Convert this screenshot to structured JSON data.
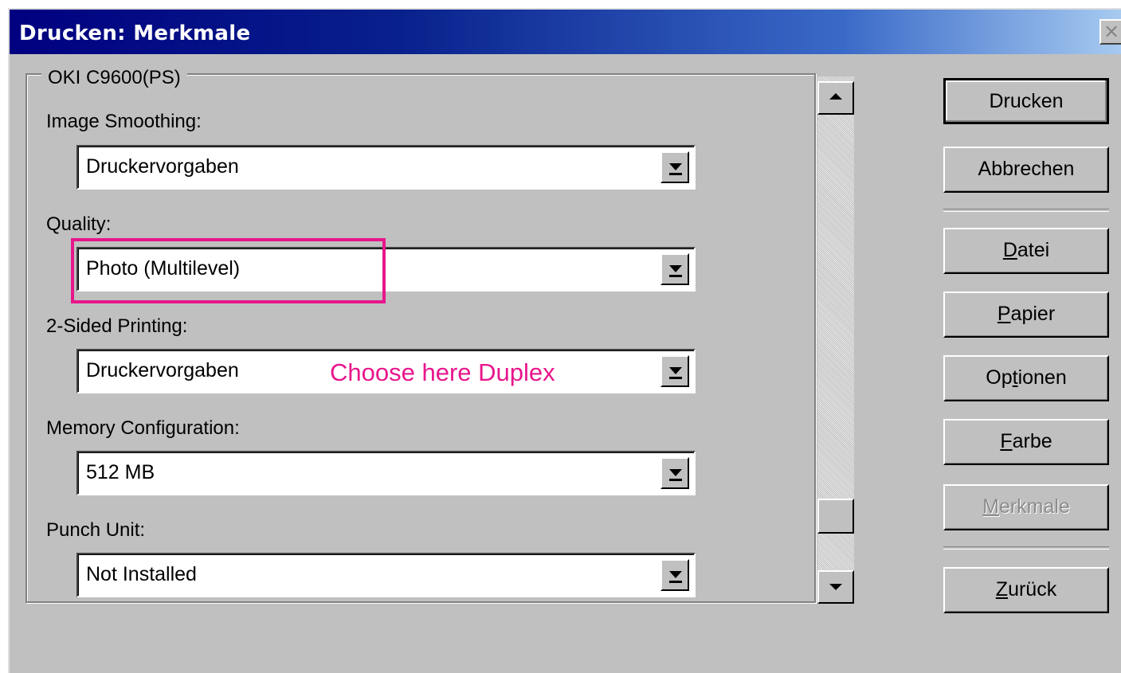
{
  "window": {
    "title": "Drucken: Merkmale",
    "close_label": "×"
  },
  "group": {
    "legend": "OKI C9600(PS)",
    "fields": [
      {
        "label": "Image Smoothing:",
        "value": "Druckervorgaben"
      },
      {
        "label": "Quality:",
        "value": "Photo (Multilevel)"
      },
      {
        "label": "2-Sided Printing:",
        "value": "Druckervorgaben"
      },
      {
        "label": "Memory Configuration:",
        "value": "512 MB"
      },
      {
        "label": "Punch Unit:",
        "value": "Not Installed"
      }
    ]
  },
  "buttons": {
    "print": "Drucken",
    "cancel": "Abbrechen",
    "file_mnemonic": "D",
    "file_rest": "atei",
    "paper_mnemonic": "P",
    "paper_rest": "apier",
    "options_pre": "Op",
    "options_mnemonic": "t",
    "options_rest": "ionen",
    "color_mnemonic": "F",
    "color_rest": "arbe",
    "features_mnemonic": "M",
    "features_rest": "erkmale",
    "back_mnemonic": "Z",
    "back_rest": "urück"
  },
  "annotation": {
    "text": "Choose here Duplex",
    "color": "#e8168c"
  },
  "colors": {
    "titlebar_start": "#000080",
    "titlebar_end": "#a6caf0",
    "dialog_face": "#c0c0c0"
  }
}
